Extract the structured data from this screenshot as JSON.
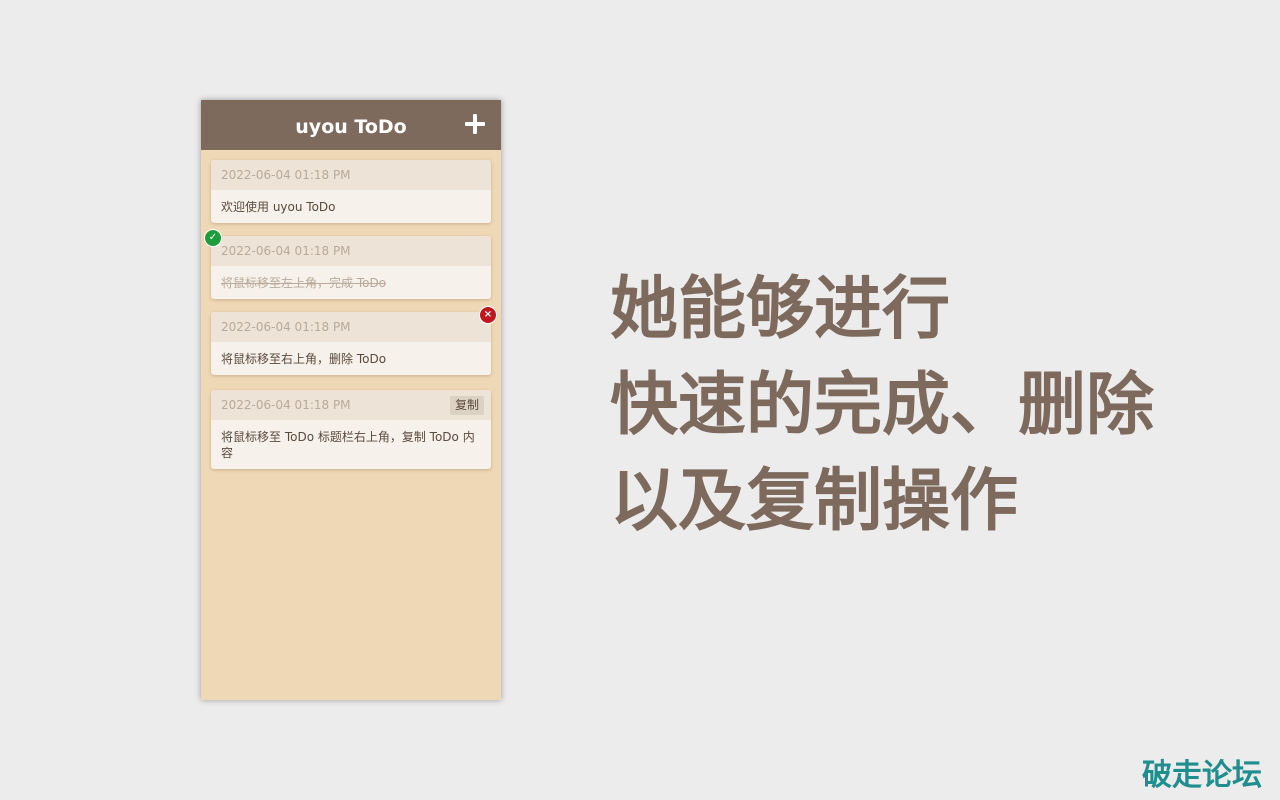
{
  "app": {
    "title": "uyou ToDo",
    "add_icon": "plus-icon"
  },
  "todos": [
    {
      "date": "2022-06-04 01:18 PM",
      "text": "欢迎使用 uyou ToDo",
      "done": false
    },
    {
      "date": "2022-06-04 01:18 PM",
      "text": "将鼠标移至左上角，完成 ToDo",
      "done": true
    },
    {
      "date": "2022-06-04 01:18 PM",
      "text": "将鼠标移至右上角，删除 ToDo",
      "done": false
    },
    {
      "date": "2022-06-04 01:18 PM",
      "text": "将鼠标移至 ToDo 标题栏右上角，复制 ToDo 内容",
      "done": false
    }
  ],
  "hover_controls": {
    "complete_icon": "check-icon",
    "complete_glyph": "✓",
    "delete_icon": "close-icon",
    "delete_glyph": "×",
    "copy_label": "复制"
  },
  "headline": {
    "line1": "她能够进行",
    "line2": "快速的完成、删除",
    "line3": "以及复制操作"
  },
  "watermark": "破走论坛",
  "colors": {
    "header": "#7d6a5d",
    "panel": "#eed8b5",
    "headline": "#7d6a5d",
    "complete": "#1f9d3a",
    "delete": "#c0161f",
    "watermark": "#1f8e8e"
  }
}
